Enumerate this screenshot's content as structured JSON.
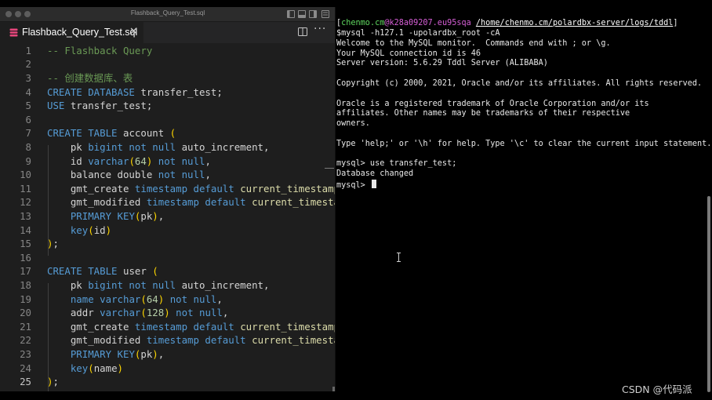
{
  "editor": {
    "window_title": "Flashback_Query_Test.sql",
    "tab_label": "Flashback_Query_Test.sql",
    "tab_close": "✕",
    "more_actions": "···",
    "lines": [
      {
        "n": "1",
        "tokens": [
          [
            "cm",
            "-- Flashback Query"
          ]
        ]
      },
      {
        "n": "2",
        "tokens": []
      },
      {
        "n": "3",
        "tokens": [
          [
            "cm",
            "-- 创建数据库、表"
          ]
        ]
      },
      {
        "n": "4",
        "tokens": [
          [
            "kw",
            "CREATE DATABASE"
          ],
          [
            "",
            " transfer_test;"
          ]
        ]
      },
      {
        "n": "5",
        "tokens": [
          [
            "kw",
            "USE"
          ],
          [
            "",
            " transfer_test;"
          ]
        ]
      },
      {
        "n": "6",
        "tokens": []
      },
      {
        "n": "7",
        "tokens": [
          [
            "kw",
            "CREATE TABLE"
          ],
          [
            "",
            " account "
          ],
          [
            "par",
            "("
          ]
        ]
      },
      {
        "n": "8",
        "tokens": [
          [
            "",
            "    pk "
          ],
          [
            "kw",
            "bigint not null"
          ],
          [
            "",
            " auto_increment,"
          ]
        ]
      },
      {
        "n": "9",
        "tokens": [
          [
            "",
            "    id "
          ],
          [
            "kw",
            "varchar"
          ],
          [
            "par",
            "("
          ],
          [
            "num",
            "64"
          ],
          [
            "par",
            ")"
          ],
          [
            "kw",
            " not null"
          ],
          [
            "",
            ","
          ]
        ]
      },
      {
        "n": "10",
        "tokens": [
          [
            "",
            "    balance double "
          ],
          [
            "kw",
            "not null"
          ],
          [
            "",
            ","
          ]
        ]
      },
      {
        "n": "11",
        "tokens": [
          [
            "",
            "    gmt_create "
          ],
          [
            "kw",
            "timestamp default"
          ],
          [
            "fn",
            " current_timestamp"
          ],
          [
            "",
            ","
          ]
        ]
      },
      {
        "n": "12",
        "tokens": [
          [
            "",
            "    gmt_modified "
          ],
          [
            "kw",
            "timestamp default"
          ],
          [
            "fn",
            " current_timestamp"
          ]
        ]
      },
      {
        "n": "13",
        "tokens": [
          [
            "",
            "    "
          ],
          [
            "kw",
            "PRIMARY KEY"
          ],
          [
            "par",
            "("
          ],
          [
            "",
            "pk"
          ],
          [
            "par",
            ")"
          ],
          [
            "",
            ","
          ]
        ]
      },
      {
        "n": "14",
        "tokens": [
          [
            "",
            "    "
          ],
          [
            "kw",
            "key"
          ],
          [
            "par",
            "("
          ],
          [
            "",
            "id"
          ],
          [
            "par",
            ")"
          ]
        ]
      },
      {
        "n": "15",
        "tokens": [
          [
            "par",
            ")"
          ],
          [
            "",
            ";"
          ]
        ]
      },
      {
        "n": "16",
        "tokens": []
      },
      {
        "n": "17",
        "tokens": [
          [
            "kw",
            "CREATE TABLE"
          ],
          [
            "",
            " user "
          ],
          [
            "par",
            "("
          ]
        ]
      },
      {
        "n": "18",
        "tokens": [
          [
            "",
            "    pk "
          ],
          [
            "kw",
            "bigint not null"
          ],
          [
            "",
            " auto_increment,"
          ]
        ]
      },
      {
        "n": "19",
        "tokens": [
          [
            "",
            "    "
          ],
          [
            "kw",
            "name"
          ],
          [
            "",
            " "
          ],
          [
            "kw",
            "varchar"
          ],
          [
            "par",
            "("
          ],
          [
            "num",
            "64"
          ],
          [
            "par",
            ")"
          ],
          [
            "kw",
            " not null"
          ],
          [
            "",
            ","
          ]
        ]
      },
      {
        "n": "20",
        "tokens": [
          [
            "",
            "    addr "
          ],
          [
            "kw",
            "varchar"
          ],
          [
            "par",
            "("
          ],
          [
            "num",
            "128"
          ],
          [
            "par",
            ")"
          ],
          [
            "kw",
            " not null"
          ],
          [
            "",
            ","
          ]
        ]
      },
      {
        "n": "21",
        "tokens": [
          [
            "",
            "    gmt_create "
          ],
          [
            "kw",
            "timestamp default"
          ],
          [
            "fn",
            " current_timestamp"
          ],
          [
            "",
            ","
          ]
        ]
      },
      {
        "n": "22",
        "tokens": [
          [
            "",
            "    gmt_modified "
          ],
          [
            "kw",
            "timestamp default"
          ],
          [
            "fn",
            " current_timestamp"
          ]
        ]
      },
      {
        "n": "23",
        "tokens": [
          [
            "",
            "    "
          ],
          [
            "kw",
            "PRIMARY KEY"
          ],
          [
            "par",
            "("
          ],
          [
            "",
            "pk"
          ],
          [
            "par",
            ")"
          ],
          [
            "",
            ","
          ]
        ]
      },
      {
        "n": "24",
        "tokens": [
          [
            "",
            "    "
          ],
          [
            "kw",
            "key"
          ],
          [
            "par",
            "("
          ],
          [
            "",
            "name"
          ],
          [
            "par",
            ")"
          ]
        ]
      },
      {
        "n": "25",
        "tokens": [
          [
            "par",
            ")"
          ],
          [
            "",
            ";"
          ]
        ]
      }
    ]
  },
  "terminal": {
    "prompt_user": "chenmo.cm",
    "prompt_host": "@k28a09207.eu95sqa",
    "prompt_path": "/home/chenmo.cm/polardbx-server/logs/tddl",
    "lines": [
      "$mysql -h127.1 -upolardbx_root -cA",
      "Welcome to the MySQL monitor.  Commands end with ; or \\g.",
      "Your MySQL connection id is 46",
      "Server version: 5.6.29 Tddl Server (ALIBABA)",
      "",
      "Copyright (c) 2000, 2021, Oracle and/or its affiliates. All rights reserved.",
      "",
      "Oracle is a registered trademark of Oracle Corporation and/or its",
      "affiliates. Other names may be trademarks of their respective",
      "owners.",
      "",
      "Type 'help;' or '\\h' for help. Type '\\c' to clear the current input statement.",
      "",
      "mysql> use transfer_test;",
      "Database changed"
    ],
    "current_prompt": "mysql> "
  },
  "watermark": "CSDN @代码派",
  "colors": {
    "editor_bg": "#1e1e1e",
    "comment": "#6a9955",
    "keyword": "#569cd6",
    "number": "#b5cea8",
    "bracket": "#ffd700",
    "function": "#dcdcaa",
    "terminal_user": "#5fd75f",
    "terminal_host": "#d75fd7"
  }
}
